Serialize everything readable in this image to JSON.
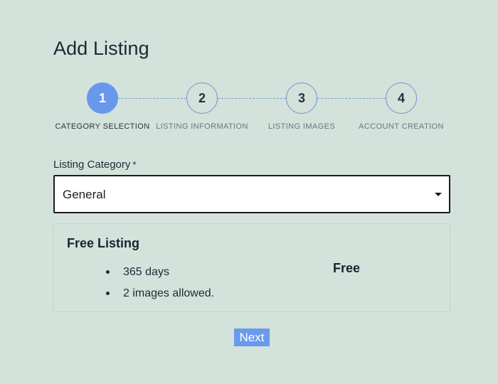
{
  "page": {
    "title": "Add Listing"
  },
  "stepper": {
    "current_step": 1,
    "steps": [
      {
        "number": "1",
        "label": "CATEGORY SELECTION"
      },
      {
        "number": "2",
        "label": "LISTING INFORMATION"
      },
      {
        "number": "3",
        "label": "LISTING IMAGES"
      },
      {
        "number": "4",
        "label": "ACCOUNT CREATION"
      }
    ]
  },
  "category_field": {
    "label": "Listing Category",
    "required_marker": "*",
    "selected_value": "General"
  },
  "plan": {
    "name": "Free Listing",
    "features": [
      "365 days",
      "2 images allowed."
    ],
    "price": "Free"
  },
  "actions": {
    "next_label": "Next"
  },
  "colors": {
    "background": "#d3e2db",
    "accent": "#6897ec",
    "step_outline": "#6f97cc"
  }
}
